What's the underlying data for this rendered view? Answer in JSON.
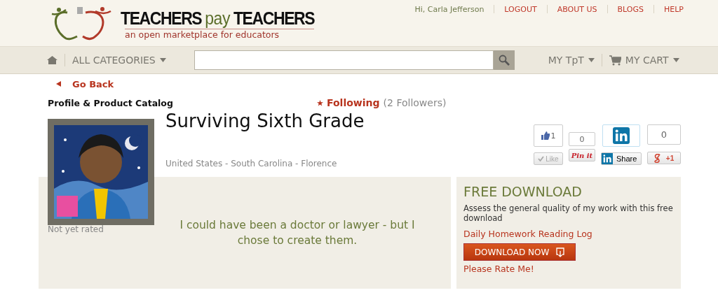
{
  "header": {
    "logo": {
      "parts": [
        {
          "text": "TEACHERS",
          "kind": "plain"
        },
        {
          "text": "pay",
          "kind": "accent"
        },
        {
          "text": "TEACHERS",
          "kind": "plain"
        }
      ],
      "tagline": "an open marketplace for educators"
    },
    "greeting": "Hi, Carla Jefferson",
    "links": [
      "LOGOUT",
      "ABOUT US",
      "BLOGS",
      "HELP"
    ]
  },
  "nav": {
    "categories": "ALL CATEGORIES",
    "my_tpt": "MY TpT",
    "cart": "MY CART"
  },
  "back_link": "Go Back",
  "section_title": "Profile & Product Catalog",
  "follow": {
    "label": "Following",
    "followers": "(2 Followers)"
  },
  "store": {
    "name": "Surviving Sixth Grade",
    "location": "United States - South Carolina - Florence",
    "rating": "Not yet rated",
    "quote": "I could have been a doctor or lawyer - but I chose to create them."
  },
  "social": [
    {
      "kind": "facebook",
      "count": "1",
      "label": "Like"
    },
    {
      "kind": "pinterest",
      "count": "0",
      "label": "Pin it"
    },
    {
      "kind": "linkedin",
      "label": "Share"
    },
    {
      "kind": "google",
      "count": "0",
      "label": "+1"
    }
  ],
  "free_download": {
    "title": "FREE DOWNLOAD",
    "description": "Assess the general quality of my work with this free download",
    "product": "Daily Homework Reading Log",
    "button": "DOWNLOAD NOW",
    "rate": "Please Rate Me!"
  }
}
